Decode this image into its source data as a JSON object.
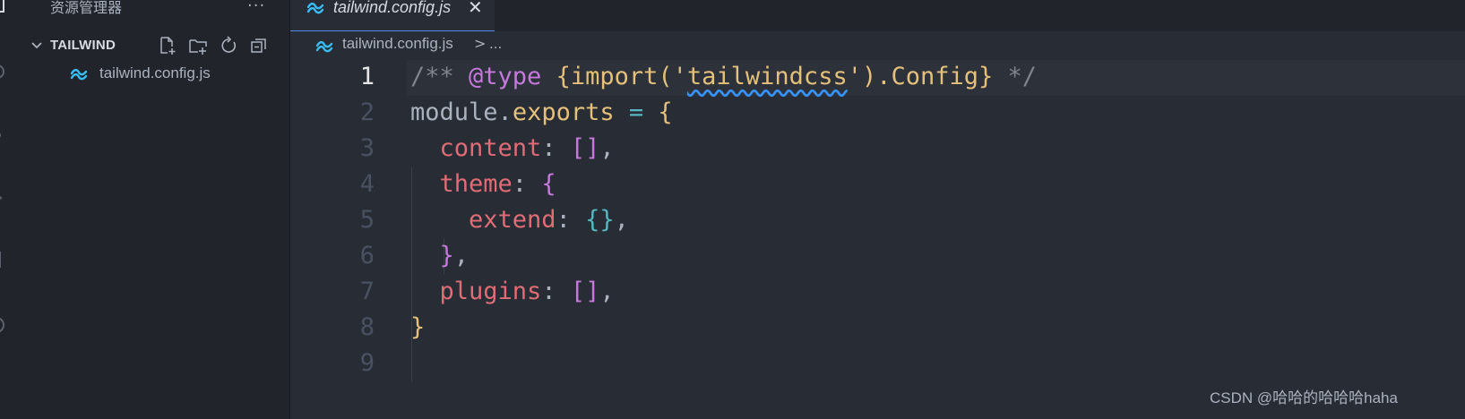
{
  "sidebar": {
    "title": "资源管理器",
    "more_label": "···",
    "section": {
      "title": "TAILWIND",
      "actions": [
        "new-file-icon",
        "new-folder-icon",
        "refresh-icon",
        "collapse-all-icon"
      ]
    },
    "files": [
      {
        "label": "tailwind.config.js",
        "icon": "tailwind-icon"
      }
    ]
  },
  "tabs": [
    {
      "label": "tailwind.config.js",
      "close": "✕",
      "active": true
    }
  ],
  "breadcrumb": {
    "file": "tailwind.config.js",
    "separator": ">",
    "more": "..."
  },
  "editor": {
    "active_line": 1,
    "lines": [
      {
        "num": "1",
        "text": "/** @type {import('tailwindcss').Config} */"
      },
      {
        "num": "2",
        "text": "module.exports = {"
      },
      {
        "num": "3",
        "text": "  content: [],"
      },
      {
        "num": "4",
        "text": "  theme: {"
      },
      {
        "num": "5",
        "text": "    extend: {},"
      },
      {
        "num": "6",
        "text": "  },"
      },
      {
        "num": "7",
        "text": "  plugins: [],"
      },
      {
        "num": "8",
        "text": "}"
      },
      {
        "num": "9",
        "text": ""
      }
    ]
  },
  "watermark": "CSDN @哈哈的哈哈哈haha",
  "colors": {
    "background": "#282c34",
    "sidebar": "#21252b",
    "keyword": "#c678dd",
    "property": "#e06c75",
    "type": "#e5c07b",
    "comment": "#7f848e",
    "accent": "#528bff"
  }
}
